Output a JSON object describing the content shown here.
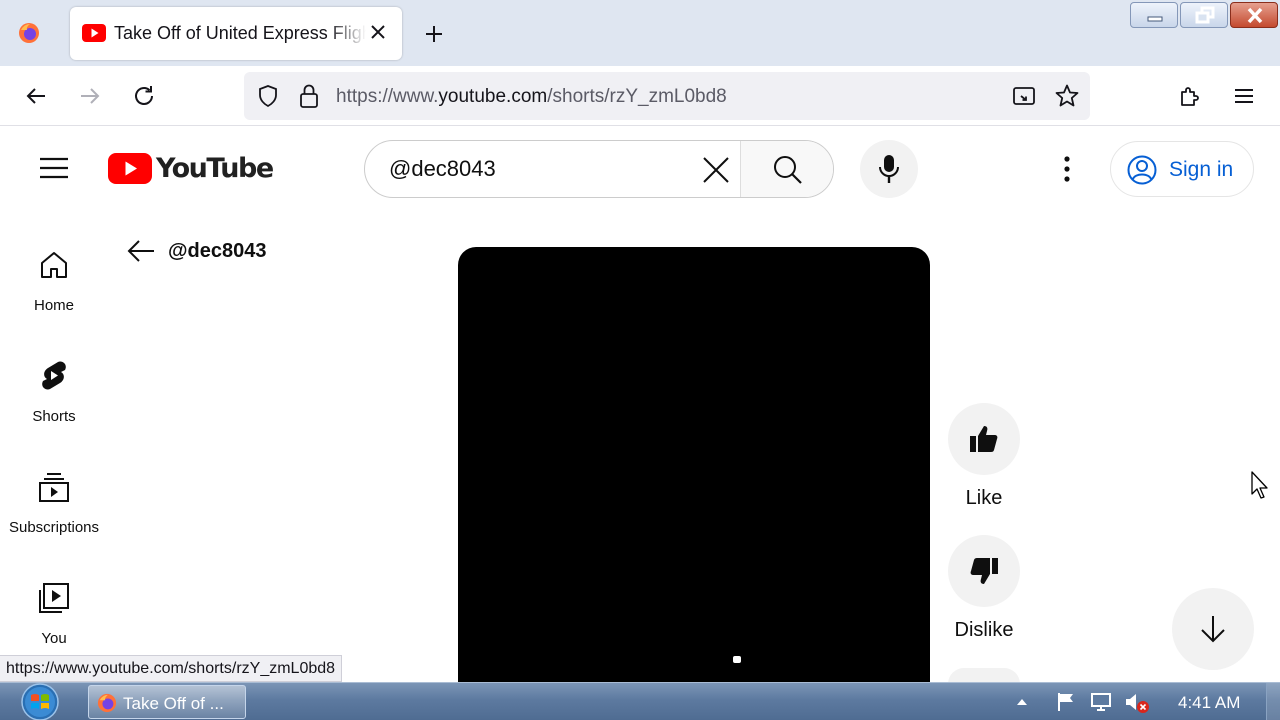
{
  "browser": {
    "tab_title": "Take Off of United Express Flight",
    "url_prefix": "https://www.",
    "url_host": "youtube.com",
    "url_path": "/shorts/rzY_zmL0bd8",
    "status_url": "https://www.youtube.com/shorts/rzY_zmL0bd8"
  },
  "youtube": {
    "logo_text": "YouTube",
    "search_value": "@dec8043",
    "sign_in_label": "Sign in",
    "sidebar": [
      {
        "label": "Home"
      },
      {
        "label": "Shorts"
      },
      {
        "label": "Subscriptions"
      },
      {
        "label": "You"
      }
    ],
    "channel_handle": "@dec8043",
    "actions": {
      "like_label": "Like",
      "dislike_label": "Dislike"
    }
  },
  "taskbar": {
    "window_label": "Take Off of ...",
    "clock": "4:41 AM"
  },
  "colors": {
    "youtube_red": "#ff0000",
    "link_blue": "#065fd4",
    "taskbar": "#5d7aa0"
  }
}
